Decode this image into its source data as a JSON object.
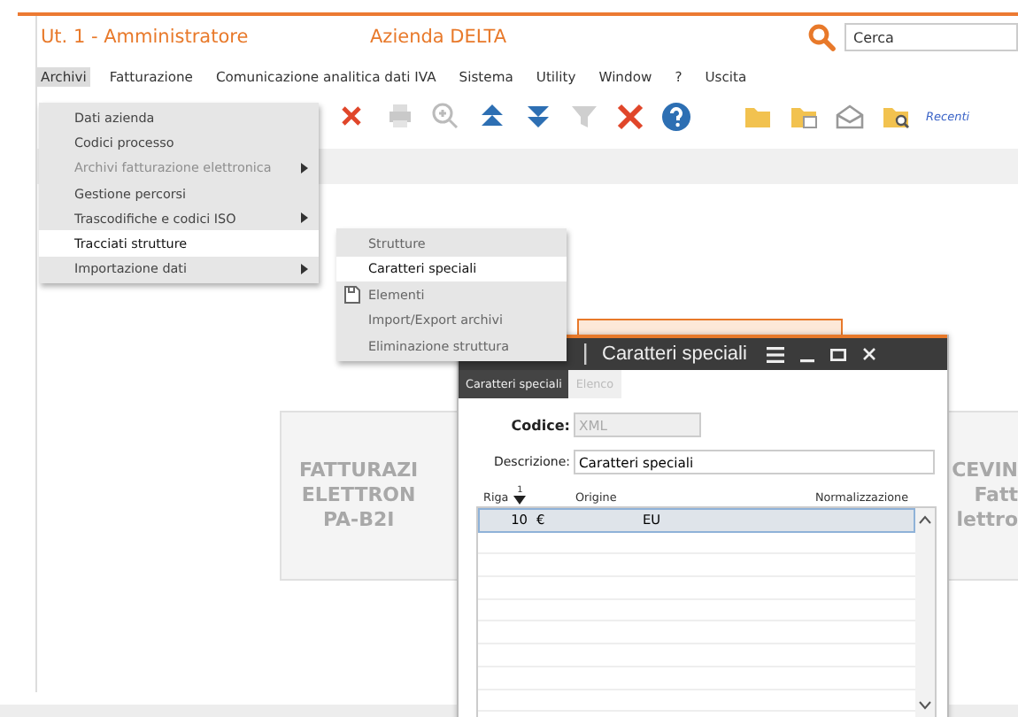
{
  "header": {
    "user": "Ut. 1 - Amministratore",
    "company": "Azienda DELTA",
    "search": {
      "placeholder": "Cerca"
    }
  },
  "menubar": [
    {
      "label": "Archivi",
      "selected": true
    },
    {
      "label": "Fatturazione",
      "selected": false
    },
    {
      "label": "Comunicazione analitica dati IVA",
      "selected": false
    },
    {
      "label": "Sistema",
      "selected": false
    },
    {
      "label": "Utility",
      "selected": false
    },
    {
      "label": "Window",
      "selected": false
    },
    {
      "label": "?",
      "selected": false
    },
    {
      "label": "Uscita",
      "selected": false
    }
  ],
  "toolbar": {
    "recent_link": "Recenti"
  },
  "background_card": {
    "left_lines": [
      "FATTURAZI",
      "ELETTRON",
      "PA-B2I"
    ],
    "right_lines": [
      "CEVIN",
      "Fatt",
      "lettro"
    ]
  },
  "menu": [
    {
      "label": "Dati azienda",
      "disabled": false,
      "submenu": false,
      "selected": false
    },
    {
      "label": "Codici processo",
      "disabled": false,
      "submenu": false,
      "selected": false
    },
    {
      "label": "Archivi fatturazione elettronica",
      "disabled": true,
      "submenu": true,
      "selected": false
    },
    {
      "label": "Gestione percorsi",
      "disabled": false,
      "submenu": false,
      "selected": false
    },
    {
      "label": "Trascodifiche e codici ISO",
      "disabled": false,
      "submenu": true,
      "selected": false
    },
    {
      "label": "Tracciati strutture",
      "disabled": false,
      "submenu": false,
      "selected": true
    },
    {
      "label": "Importazione dati",
      "disabled": false,
      "submenu": true,
      "selected": false
    }
  ],
  "submenu": [
    {
      "label": "Strutture",
      "selected": false,
      "icon": false
    },
    {
      "label": "Caratteri speciali",
      "selected": true,
      "icon": false
    },
    {
      "label": "Elementi",
      "selected": false,
      "icon": true
    },
    {
      "label": "Import/Export archivi",
      "selected": false,
      "icon": false
    },
    {
      "label": "Eliminazione struttura",
      "selected": false,
      "icon": false
    }
  ],
  "dialog": {
    "title": "Caratteri speciali",
    "tabs": [
      {
        "label": "Caratteri speciali",
        "selected": true
      },
      {
        "label": "Elenco",
        "selected": false
      }
    ],
    "codice_label": "Codice:",
    "codice": "XML",
    "descrizione_label": "Descrizione:",
    "descrizione": "Caratteri speciali",
    "columns": [
      "Riga",
      "Origine",
      "Normalizzazione"
    ],
    "sort_mark": "1",
    "rows": [
      {
        "riga": "10",
        "origine": "€",
        "normalizzazione": "EU",
        "selected": true
      }
    ]
  }
}
